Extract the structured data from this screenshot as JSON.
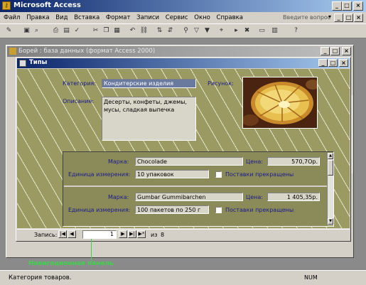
{
  "app": {
    "title": "Microsoft Access",
    "icon": "key-icon",
    "controls": [
      "_",
      "□",
      "×"
    ]
  },
  "menu": {
    "items": [
      "Файл",
      "Правка",
      "Вид",
      "Вставка",
      "Формат",
      "Записи",
      "Сервис",
      "Окно",
      "Справка"
    ],
    "ask_placeholder": "Введите вопрос",
    "ask_arrow": "▾",
    "controls": [
      "_",
      "□",
      "×"
    ]
  },
  "db_window": {
    "title": "Борей : база данных (формат Access 2000)",
    "controls": [
      "_",
      "□",
      "×"
    ]
  },
  "form_window": {
    "title": "Типы",
    "controls": [
      "_",
      "□",
      "×"
    ],
    "category_label": "Категория:",
    "category_value": "Кондитерские изделия",
    "picture_label": "Рисунок:",
    "description_label": "Описание:",
    "description_value": "Десерты, конфеты, джемы,\nмусы, сладкая выпечка",
    "subform_rows": [
      {
        "brand_label": "Марка:",
        "brand_value": "Chocolade",
        "price_label": "Цена:",
        "price_value": "570,7Ор.",
        "unit_label": "Единица измерения:",
        "unit_value": "10 упаковок",
        "discontinued_label": "Поставки прекращены"
      },
      {
        "brand_label": "Марка:",
        "brand_value": "Gumbar Gummibarchen",
        "price_label": "Цена:",
        "price_value": "1 405,35р.",
        "unit_label": "Единица измерения:",
        "unit_value": "100 пакетов по 250 г",
        "discontinued_label": "Поставки прекращены"
      }
    ],
    "navbar": {
      "record_label": "Запись:",
      "first": "|◀",
      "prev": "◀",
      "current": "1",
      "next": "▶",
      "last": "▶|",
      "new": "▶*",
      "count_label": "из",
      "count": "8"
    }
  },
  "annotation": {
    "text": "Навигационная панель",
    "color": "#3dd34a"
  },
  "statusbar": {
    "text": "Категория товаров.",
    "num": "NUM"
  },
  "colors": {
    "title_blue": "#0a246a",
    "form_bg": "#9a9a62",
    "label_blue": "#1b1b8c",
    "gray": "#d4d0c8"
  }
}
